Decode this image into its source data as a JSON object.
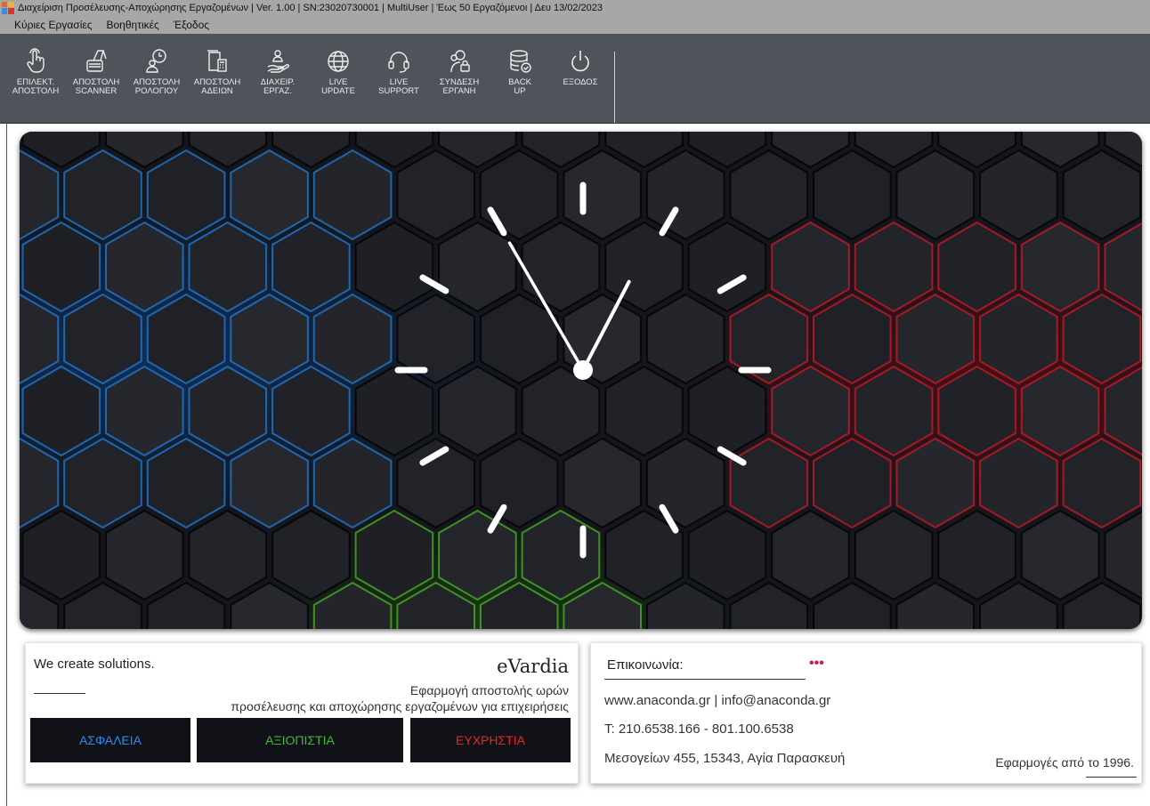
{
  "window": {
    "title": "Διαχείριση Προσέλευσης-Αποχώρησης Εργαζομένων | Ver. 1.00 | SN:23020730001 | MultiUser | Έως 50 Εργαζόμενοι | Δευ 13/02/2023"
  },
  "menu": [
    "Κύριες Εργασίες",
    "Βοηθητικές",
    "Έξοδος"
  ],
  "toolbar": [
    {
      "label": "ΕΠΙΛΕΚΤ.\nΑΠΟΣΤΟΛΗ",
      "icon": "hand-pointer-icon"
    },
    {
      "label": "ΑΠΟΣΤΟΛΗ\nSCANNER",
      "icon": "scanner-icon"
    },
    {
      "label": "ΑΠΟΣΤΟΛΗ\nΡΟΛΟΓΙΟΥ",
      "icon": "clock-user-icon"
    },
    {
      "label": "ΑΠΟΣΤΟΛΗ\nΑΔΕΙΩΝ",
      "icon": "document-calculator-icon"
    },
    {
      "label": "ΔΙΑΧΕΙΡ.\nΕΡΓΑΖ.",
      "icon": "employee-hand-icon"
    },
    {
      "label": "LIVE\nUPDATE",
      "icon": "globe-icon"
    },
    {
      "label": "LIVE\nSUPPORT",
      "icon": "headset-icon"
    },
    {
      "label": "ΣΥΝΔΕΣΗ\nΕΡΓΑΝΗ",
      "icon": "users-lock-icon"
    },
    {
      "label": "BACK\nUP",
      "icon": "database-check-icon"
    },
    {
      "label": "ΕΞΟΔΟΣ",
      "icon": "power-icon"
    }
  ],
  "clock": {
    "hour": 12,
    "minute": 55
  },
  "info": {
    "slogan": "We create solutions.",
    "brand": "eVardia",
    "description": "Εφαρμογή αποστολής ωρών\nπροσέλευσης και αποχώρησης εργαζομένων για επιχειρήσεις",
    "tags": [
      {
        "text": "ΑΣΦΑΛΕΙΑ",
        "color": "#2a8bf0"
      },
      {
        "text": "ΑΞΙΟΠΙΣΤΙΑ",
        "color": "#3fbb39"
      },
      {
        "text": "ΕΥΧΡΗΣΤΙΑ",
        "color": "#e02a2a"
      }
    ]
  },
  "contact": {
    "title": "Επικοινωνία:",
    "dots": "•••",
    "web": "www.anaconda.gr | info@anaconda.gr",
    "phone": "T: 210.6538.166 - 801.100.6538",
    "address": "Μεσογείων 455, 15343, Αγία Παρασκευή",
    "since": "Εφαρμογές από το 1996."
  }
}
